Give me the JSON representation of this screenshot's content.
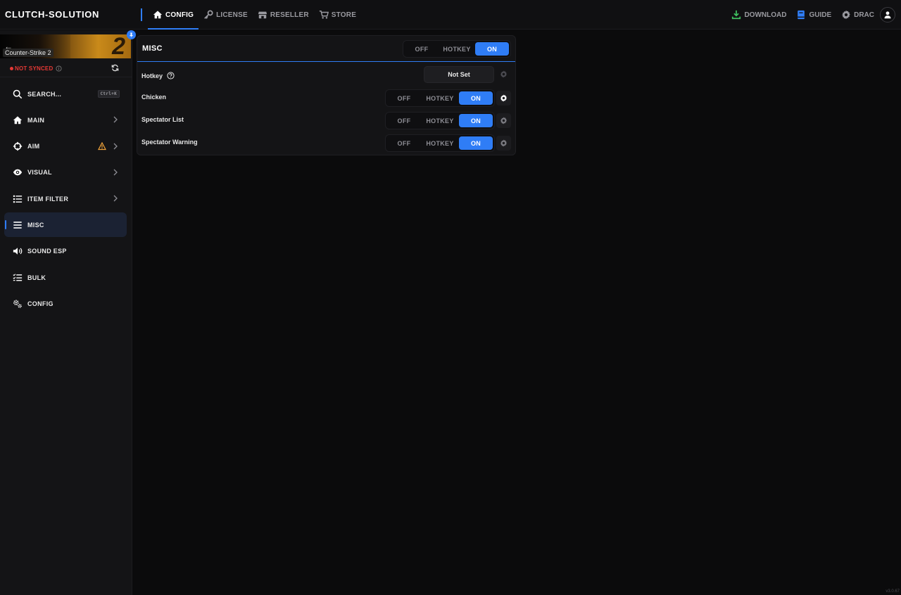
{
  "app": {
    "brand": "CLUTCH-SOLUTION",
    "version": "v3.0.67"
  },
  "colors": {
    "accent": "#2f7df6",
    "danger": "#e53935",
    "warning": "#f0a33a",
    "download": "#3fbf5f",
    "guide": "#2f7df6"
  },
  "topnav": {
    "items": [
      {
        "label": "CONFIG",
        "icon": "home-icon",
        "active": true
      },
      {
        "label": "LICENSE",
        "icon": "key-icon",
        "active": false
      },
      {
        "label": "RESELLER",
        "icon": "store-icon",
        "active": false
      },
      {
        "label": "STORE",
        "icon": "cart-icon",
        "active": false
      }
    ],
    "right": {
      "download": "DOWNLOAD",
      "guide": "GUIDE",
      "user": "DRAC"
    }
  },
  "sidebar": {
    "game_title": "Counter-Strike 2",
    "sync_status": "NOT SYNCED",
    "search_label": "SEARCH...",
    "search_shortcut": "Ctrl+K",
    "items": [
      {
        "label": "MAIN",
        "icon": "home-icon",
        "chevron": true
      },
      {
        "label": "AIM",
        "icon": "crosshair-icon",
        "chevron": true,
        "warning": true
      },
      {
        "label": "VISUAL",
        "icon": "eye-icon",
        "chevron": true
      },
      {
        "label": "ITEM FILTER",
        "icon": "list-icon",
        "chevron": true
      },
      {
        "label": "MISC",
        "icon": "menu-icon",
        "active": true
      },
      {
        "label": "SOUND ESP",
        "icon": "speaker-icon"
      },
      {
        "label": "BULK",
        "icon": "checklist-icon"
      },
      {
        "label": "CONFIG",
        "icon": "gears-icon"
      }
    ]
  },
  "panel": {
    "title": "MISC",
    "header_toggle": {
      "off": "OFF",
      "hotkey": "HOTKEY",
      "on": "ON",
      "selected": "ON"
    },
    "hotkey_row": {
      "label": "Hotkey",
      "value": "Not Set"
    },
    "rows": [
      {
        "label": "Chicken",
        "off": "OFF",
        "hotkey": "HOTKEY",
        "on": "ON",
        "selected": "ON"
      },
      {
        "label": "Spectator List",
        "off": "OFF",
        "hotkey": "HOTKEY",
        "on": "ON",
        "selected": "ON"
      },
      {
        "label": "Spectator Warning",
        "off": "OFF",
        "hotkey": "HOTKEY",
        "on": "ON",
        "selected": "ON"
      }
    ]
  }
}
